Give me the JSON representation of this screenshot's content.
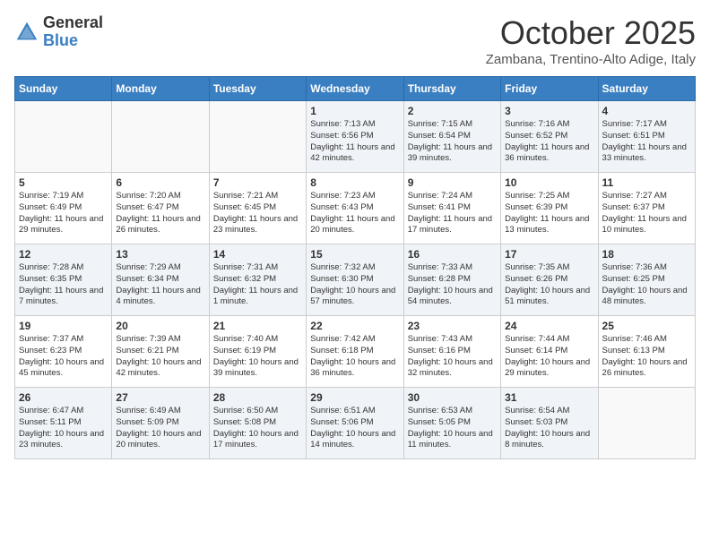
{
  "header": {
    "logo_general": "General",
    "logo_blue": "Blue",
    "month_title": "October 2025",
    "subtitle": "Zambana, Trentino-Alto Adige, Italy"
  },
  "days_of_week": [
    "Sunday",
    "Monday",
    "Tuesday",
    "Wednesday",
    "Thursday",
    "Friday",
    "Saturday"
  ],
  "weeks": [
    [
      {
        "day": "",
        "info": ""
      },
      {
        "day": "",
        "info": ""
      },
      {
        "day": "",
        "info": ""
      },
      {
        "day": "1",
        "info": "Sunrise: 7:13 AM\nSunset: 6:56 PM\nDaylight: 11 hours and 42 minutes."
      },
      {
        "day": "2",
        "info": "Sunrise: 7:15 AM\nSunset: 6:54 PM\nDaylight: 11 hours and 39 minutes."
      },
      {
        "day": "3",
        "info": "Sunrise: 7:16 AM\nSunset: 6:52 PM\nDaylight: 11 hours and 36 minutes."
      },
      {
        "day": "4",
        "info": "Sunrise: 7:17 AM\nSunset: 6:51 PM\nDaylight: 11 hours and 33 minutes."
      }
    ],
    [
      {
        "day": "5",
        "info": "Sunrise: 7:19 AM\nSunset: 6:49 PM\nDaylight: 11 hours and 29 minutes."
      },
      {
        "day": "6",
        "info": "Sunrise: 7:20 AM\nSunset: 6:47 PM\nDaylight: 11 hours and 26 minutes."
      },
      {
        "day": "7",
        "info": "Sunrise: 7:21 AM\nSunset: 6:45 PM\nDaylight: 11 hours and 23 minutes."
      },
      {
        "day": "8",
        "info": "Sunrise: 7:23 AM\nSunset: 6:43 PM\nDaylight: 11 hours and 20 minutes."
      },
      {
        "day": "9",
        "info": "Sunrise: 7:24 AM\nSunset: 6:41 PM\nDaylight: 11 hours and 17 minutes."
      },
      {
        "day": "10",
        "info": "Sunrise: 7:25 AM\nSunset: 6:39 PM\nDaylight: 11 hours and 13 minutes."
      },
      {
        "day": "11",
        "info": "Sunrise: 7:27 AM\nSunset: 6:37 PM\nDaylight: 11 hours and 10 minutes."
      }
    ],
    [
      {
        "day": "12",
        "info": "Sunrise: 7:28 AM\nSunset: 6:35 PM\nDaylight: 11 hours and 7 minutes."
      },
      {
        "day": "13",
        "info": "Sunrise: 7:29 AM\nSunset: 6:34 PM\nDaylight: 11 hours and 4 minutes."
      },
      {
        "day": "14",
        "info": "Sunrise: 7:31 AM\nSunset: 6:32 PM\nDaylight: 11 hours and 1 minute."
      },
      {
        "day": "15",
        "info": "Sunrise: 7:32 AM\nSunset: 6:30 PM\nDaylight: 10 hours and 57 minutes."
      },
      {
        "day": "16",
        "info": "Sunrise: 7:33 AM\nSunset: 6:28 PM\nDaylight: 10 hours and 54 minutes."
      },
      {
        "day": "17",
        "info": "Sunrise: 7:35 AM\nSunset: 6:26 PM\nDaylight: 10 hours and 51 minutes."
      },
      {
        "day": "18",
        "info": "Sunrise: 7:36 AM\nSunset: 6:25 PM\nDaylight: 10 hours and 48 minutes."
      }
    ],
    [
      {
        "day": "19",
        "info": "Sunrise: 7:37 AM\nSunset: 6:23 PM\nDaylight: 10 hours and 45 minutes."
      },
      {
        "day": "20",
        "info": "Sunrise: 7:39 AM\nSunset: 6:21 PM\nDaylight: 10 hours and 42 minutes."
      },
      {
        "day": "21",
        "info": "Sunrise: 7:40 AM\nSunset: 6:19 PM\nDaylight: 10 hours and 39 minutes."
      },
      {
        "day": "22",
        "info": "Sunrise: 7:42 AM\nSunset: 6:18 PM\nDaylight: 10 hours and 36 minutes."
      },
      {
        "day": "23",
        "info": "Sunrise: 7:43 AM\nSunset: 6:16 PM\nDaylight: 10 hours and 32 minutes."
      },
      {
        "day": "24",
        "info": "Sunrise: 7:44 AM\nSunset: 6:14 PM\nDaylight: 10 hours and 29 minutes."
      },
      {
        "day": "25",
        "info": "Sunrise: 7:46 AM\nSunset: 6:13 PM\nDaylight: 10 hours and 26 minutes."
      }
    ],
    [
      {
        "day": "26",
        "info": "Sunrise: 6:47 AM\nSunset: 5:11 PM\nDaylight: 10 hours and 23 minutes."
      },
      {
        "day": "27",
        "info": "Sunrise: 6:49 AM\nSunset: 5:09 PM\nDaylight: 10 hours and 20 minutes."
      },
      {
        "day": "28",
        "info": "Sunrise: 6:50 AM\nSunset: 5:08 PM\nDaylight: 10 hours and 17 minutes."
      },
      {
        "day": "29",
        "info": "Sunrise: 6:51 AM\nSunset: 5:06 PM\nDaylight: 10 hours and 14 minutes."
      },
      {
        "day": "30",
        "info": "Sunrise: 6:53 AM\nSunset: 5:05 PM\nDaylight: 10 hours and 11 minutes."
      },
      {
        "day": "31",
        "info": "Sunrise: 6:54 AM\nSunset: 5:03 PM\nDaylight: 10 hours and 8 minutes."
      },
      {
        "day": "",
        "info": ""
      }
    ]
  ]
}
